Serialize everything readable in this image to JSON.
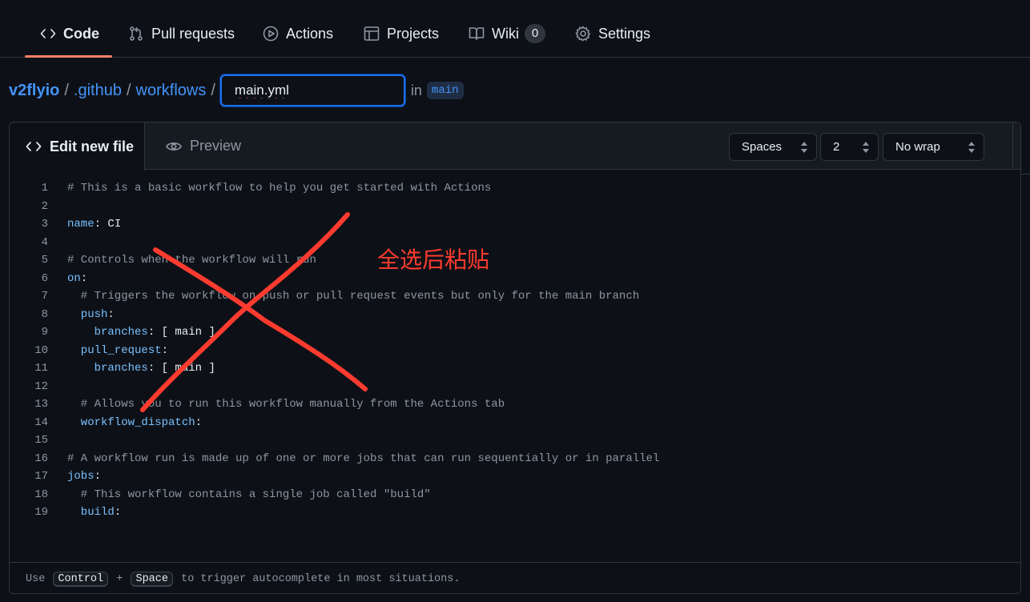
{
  "nav": {
    "tabs": [
      {
        "label": "Code",
        "icon": "code-icon",
        "active": true
      },
      {
        "label": "Pull requests",
        "icon": "pull-request-icon"
      },
      {
        "label": "Actions",
        "icon": "play-icon"
      },
      {
        "label": "Projects",
        "icon": "table-icon"
      },
      {
        "label": "Wiki",
        "icon": "book-icon",
        "counter": "0"
      },
      {
        "label": "Settings",
        "icon": "gear-icon"
      }
    ],
    "accent": "#f78166"
  },
  "breadcrumb": {
    "owner": "v2flyio",
    "dir1": ".github",
    "dir2": "workflows",
    "separator": "/",
    "filename": "main.yml",
    "in_label": "in",
    "branch": "main"
  },
  "editor": {
    "tab_edit": "Edit new file",
    "tab_preview": "Preview",
    "indent_mode": "Spaces",
    "indent_size": "2",
    "wrap_mode": "No wrap",
    "lines": [
      {
        "n": "1",
        "parts": [
          {
            "t": "# This is a basic workflow to help you get started with Actions",
            "c": "c"
          }
        ]
      },
      {
        "n": "2",
        "parts": []
      },
      {
        "n": "3",
        "parts": [
          {
            "t": "name",
            "c": "k"
          },
          {
            "t": ": CI",
            "c": ""
          }
        ]
      },
      {
        "n": "4",
        "parts": []
      },
      {
        "n": "5",
        "parts": [
          {
            "t": "# Controls when the workflow will run",
            "c": "c"
          }
        ]
      },
      {
        "n": "6",
        "parts": [
          {
            "t": "on",
            "c": "k"
          },
          {
            "t": ":",
            "c": ""
          }
        ]
      },
      {
        "n": "7",
        "parts": [
          {
            "t": "  # Triggers the workflow on push or pull request events but only for the main branch",
            "c": "c"
          }
        ]
      },
      {
        "n": "8",
        "parts": [
          {
            "t": "  push",
            "c": "k"
          },
          {
            "t": ":",
            "c": ""
          }
        ]
      },
      {
        "n": "9",
        "parts": [
          {
            "t": "    branches",
            "c": "k"
          },
          {
            "t": ": [ main ]",
            "c": ""
          }
        ]
      },
      {
        "n": "10",
        "parts": [
          {
            "t": "  pull_request",
            "c": "k"
          },
          {
            "t": ":",
            "c": ""
          }
        ]
      },
      {
        "n": "11",
        "parts": [
          {
            "t": "    branches",
            "c": "k"
          },
          {
            "t": ": [ main ]",
            "c": ""
          }
        ]
      },
      {
        "n": "12",
        "parts": []
      },
      {
        "n": "13",
        "parts": [
          {
            "t": "  # Allows you to run this workflow manually from the Actions tab",
            "c": "c"
          }
        ]
      },
      {
        "n": "14",
        "parts": [
          {
            "t": "  workflow_dispatch",
            "c": "k"
          },
          {
            "t": ":",
            "c": ""
          }
        ]
      },
      {
        "n": "15",
        "parts": []
      },
      {
        "n": "16",
        "parts": [
          {
            "t": "# A workflow run is made up of one or more jobs that can run sequentially or in parallel",
            "c": "c"
          }
        ]
      },
      {
        "n": "17",
        "parts": [
          {
            "t": "jobs",
            "c": "k"
          },
          {
            "t": ":",
            "c": ""
          }
        ]
      },
      {
        "n": "18",
        "parts": [
          {
            "t": "  # This workflow contains a single job called \"build\"",
            "c": "c"
          }
        ]
      },
      {
        "n": "19",
        "parts": [
          {
            "t": "  build",
            "c": "k"
          },
          {
            "t": ":",
            "c": ""
          }
        ]
      }
    ],
    "footer": {
      "use": "Use",
      "key1": "Control",
      "plus": "+",
      "key2": "Space",
      "rest": "to trigger autocomplete in most situations."
    }
  },
  "annotation": {
    "text": "全选后粘贴",
    "color": "#ff3b30"
  }
}
